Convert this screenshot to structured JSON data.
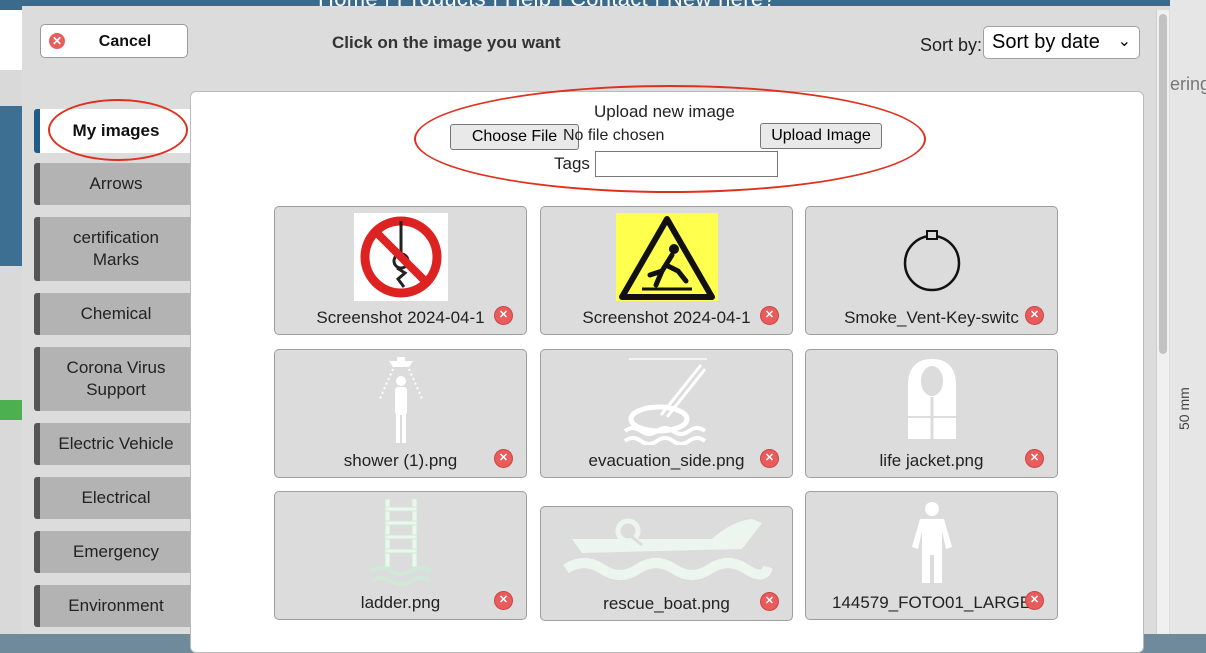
{
  "modal": {
    "cancel_label": "Cancel",
    "instruction": "Click on the image you want",
    "sort_label": "Sort by:",
    "sort_value": "Sort by date"
  },
  "categories": [
    {
      "label": "My images",
      "active": true
    },
    {
      "label": "Arrows"
    },
    {
      "label": "certification Marks"
    },
    {
      "label": "Chemical"
    },
    {
      "label": "Corona Virus Support"
    },
    {
      "label": "Electric Vehicle"
    },
    {
      "label": "Electrical"
    },
    {
      "label": "Emergency"
    },
    {
      "label": "Environment"
    }
  ],
  "upload": {
    "title": "Upload new image",
    "choose_label": "Choose File",
    "no_file_text": "No file chosen",
    "upload_label": "Upload Image",
    "tags_label": "Tags",
    "tags_value": ""
  },
  "images": [
    {
      "name": "Screenshot 2024-04-1",
      "icon": "no-rope-icon"
    },
    {
      "name": "Screenshot 2024-04-1",
      "icon": "slippery-warning-icon"
    },
    {
      "name": "Smoke_Vent-Key-switc",
      "icon": "key-switch-outline-icon"
    },
    {
      "name": "shower (1).png",
      "icon": "shower-icon"
    },
    {
      "name": "evacuation_side.png",
      "icon": "evacuation-slide-icon"
    },
    {
      "name": "life jacket.png",
      "icon": "life-jacket-icon"
    },
    {
      "name": "ladder.png",
      "icon": "ladder-icon"
    },
    {
      "name": "rescue_boat.png",
      "icon": "rescue-boat-icon"
    },
    {
      "name": "144579_FOTO01_LARGE",
      "icon": "immersion-suit-icon"
    }
  ],
  "background": {
    "nav_text": "Home  |  Products  |  Help  |  Contact  |  New here?",
    "right_fragment": "ering",
    "vertical_text": "50 mm"
  },
  "colors": {
    "highlight_ring": "#e0301e",
    "active_tab_border": "#1f5c86",
    "delete_icon": "#e85c5c"
  }
}
